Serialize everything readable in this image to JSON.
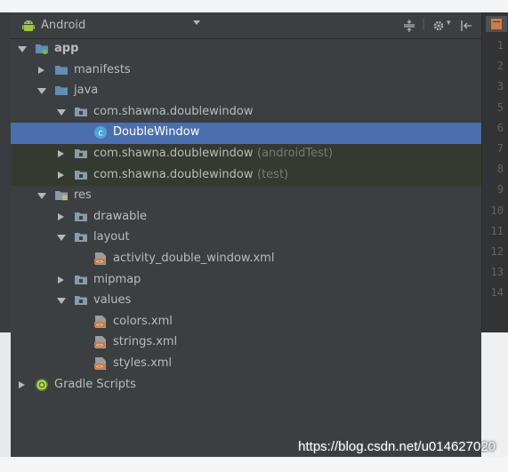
{
  "header": {
    "title": "Android",
    "icon": "android-icon",
    "toolbar_icons": [
      "collapse-all-icon",
      "settings-gear-icon",
      "hide-panel-icon"
    ]
  },
  "tree": [
    {
      "label": "app",
      "suffix": "",
      "icon": "module-folder-icon",
      "expanded": true,
      "depth": 0,
      "bold": true,
      "state": ""
    },
    {
      "label": "manifests",
      "suffix": "",
      "icon": "folder-icon",
      "expanded": false,
      "depth": 1,
      "bold": false,
      "state": ""
    },
    {
      "label": "java",
      "suffix": "",
      "icon": "folder-icon",
      "expanded": true,
      "depth": 1,
      "bold": false,
      "state": ""
    },
    {
      "label": "com.shawna.doublewindow",
      "suffix": "",
      "icon": "package-icon",
      "expanded": true,
      "depth": 2,
      "bold": false,
      "state": ""
    },
    {
      "label": "DoubleWindow",
      "suffix": "",
      "icon": "class-icon",
      "expanded": null,
      "depth": 3,
      "bold": false,
      "state": "selected"
    },
    {
      "label": "com.shawna.doublewindow",
      "suffix": "(androidTest)",
      "icon": "package-icon",
      "expanded": false,
      "depth": 2,
      "bold": false,
      "state": "green"
    },
    {
      "label": "com.shawna.doublewindow",
      "suffix": "(test)",
      "icon": "package-icon",
      "expanded": false,
      "depth": 2,
      "bold": false,
      "state": "green"
    },
    {
      "label": "res",
      "suffix": "",
      "icon": "res-folder-icon",
      "expanded": true,
      "depth": 1,
      "bold": false,
      "state": ""
    },
    {
      "label": "drawable",
      "suffix": "",
      "icon": "package-icon",
      "expanded": false,
      "depth": 2,
      "bold": false,
      "state": ""
    },
    {
      "label": "layout",
      "suffix": "",
      "icon": "package-icon",
      "expanded": true,
      "depth": 2,
      "bold": false,
      "state": ""
    },
    {
      "label": "activity_double_window.xml",
      "suffix": "",
      "icon": "xml-file-icon",
      "expanded": null,
      "depth": 3,
      "bold": false,
      "state": ""
    },
    {
      "label": "mipmap",
      "suffix": "",
      "icon": "package-icon",
      "expanded": false,
      "depth": 2,
      "bold": false,
      "state": ""
    },
    {
      "label": "values",
      "suffix": "",
      "icon": "package-icon",
      "expanded": true,
      "depth": 2,
      "bold": false,
      "state": ""
    },
    {
      "label": "colors.xml",
      "suffix": "",
      "icon": "xml-file-icon",
      "expanded": null,
      "depth": 3,
      "bold": false,
      "state": ""
    },
    {
      "label": "strings.xml",
      "suffix": "",
      "icon": "xml-file-icon",
      "expanded": null,
      "depth": 3,
      "bold": false,
      "state": ""
    },
    {
      "label": "styles.xml",
      "suffix": "",
      "icon": "xml-file-icon",
      "expanded": null,
      "depth": 3,
      "bold": false,
      "state": ""
    },
    {
      "label": "Gradle Scripts",
      "suffix": "",
      "icon": "gradle-icon",
      "expanded": false,
      "depth": 0,
      "bold": false,
      "state": ""
    }
  ],
  "editor": {
    "line_numbers": [
      "1",
      "2",
      "3",
      "5",
      "6",
      "7",
      "8",
      "9",
      "10",
      "11",
      "12",
      "13",
      "14"
    ]
  },
  "watermark": "https://blog.csdn.net/u014627020",
  "colors": {
    "panel_bg": "#3c3f41",
    "selection": "#4b6eaf",
    "test_source_bg": "#343a2e",
    "text": "#bbbbbb",
    "folder_blue": "#5f8fb5",
    "xml_orange": "#d07a48"
  }
}
